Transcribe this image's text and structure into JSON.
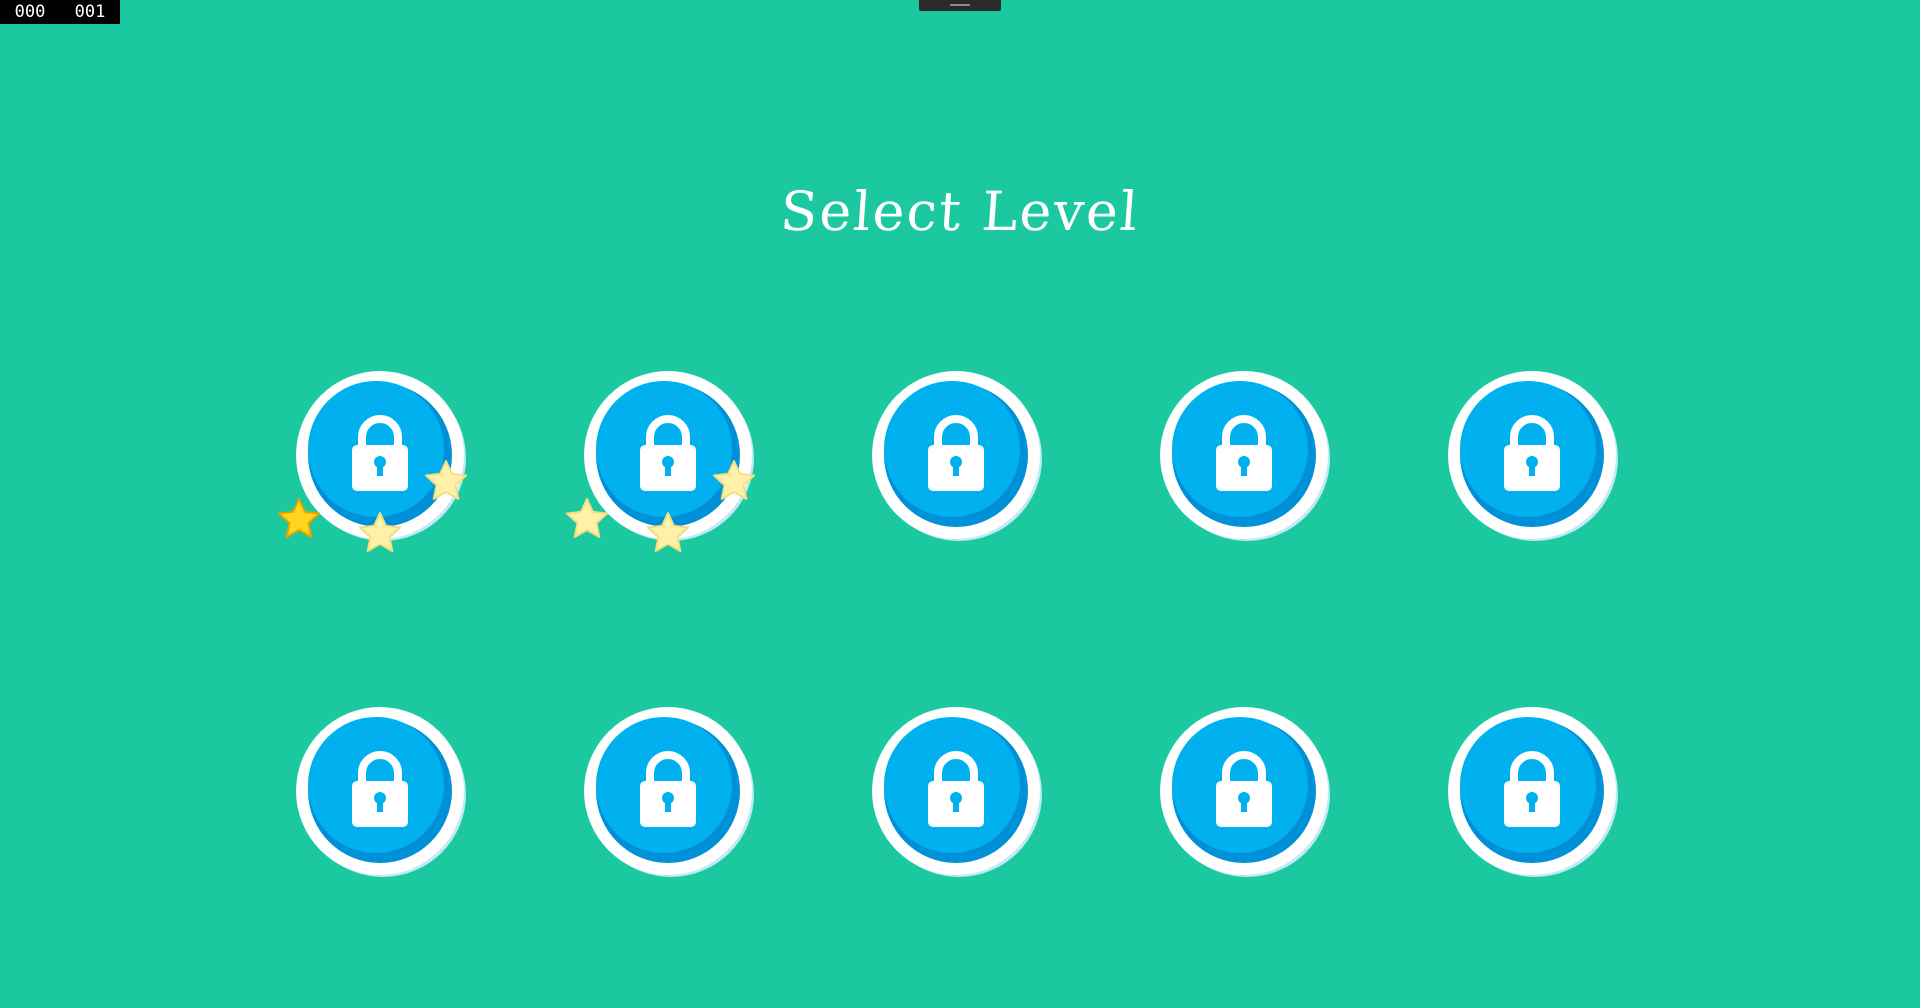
{
  "debug": {
    "counter_a": "000",
    "counter_b": "001"
  },
  "title": "Select Level",
  "colors": {
    "background": "#1bc8a0",
    "button_outer": "#ffffff",
    "button_inner": "#00b0ef",
    "button_shade": "#0090d8",
    "star_earned": "#ffd61f",
    "star_empty": "#fff1a8"
  },
  "levels": [
    {
      "row": 1,
      "col": 1,
      "locked": true,
      "icon": "lock-icon",
      "stars_shown": true,
      "stars_earned": 1,
      "stars_total": 3
    },
    {
      "row": 1,
      "col": 2,
      "locked": true,
      "icon": "lock-icon",
      "stars_shown": true,
      "stars_earned": 0,
      "stars_total": 3
    },
    {
      "row": 1,
      "col": 3,
      "locked": true,
      "icon": "lock-icon",
      "stars_shown": false
    },
    {
      "row": 1,
      "col": 4,
      "locked": true,
      "icon": "lock-icon",
      "stars_shown": false
    },
    {
      "row": 1,
      "col": 5,
      "locked": true,
      "icon": "lock-icon",
      "stars_shown": false
    },
    {
      "row": 2,
      "col": 1,
      "locked": true,
      "icon": "lock-icon",
      "stars_shown": false
    },
    {
      "row": 2,
      "col": 2,
      "locked": true,
      "icon": "lock-icon",
      "stars_shown": false
    },
    {
      "row": 2,
      "col": 3,
      "locked": true,
      "icon": "lock-icon",
      "stars_shown": false
    },
    {
      "row": 2,
      "col": 4,
      "locked": true,
      "icon": "lock-icon",
      "stars_shown": false
    },
    {
      "row": 2,
      "col": 5,
      "locked": true,
      "icon": "lock-icon",
      "stars_shown": false
    }
  ]
}
